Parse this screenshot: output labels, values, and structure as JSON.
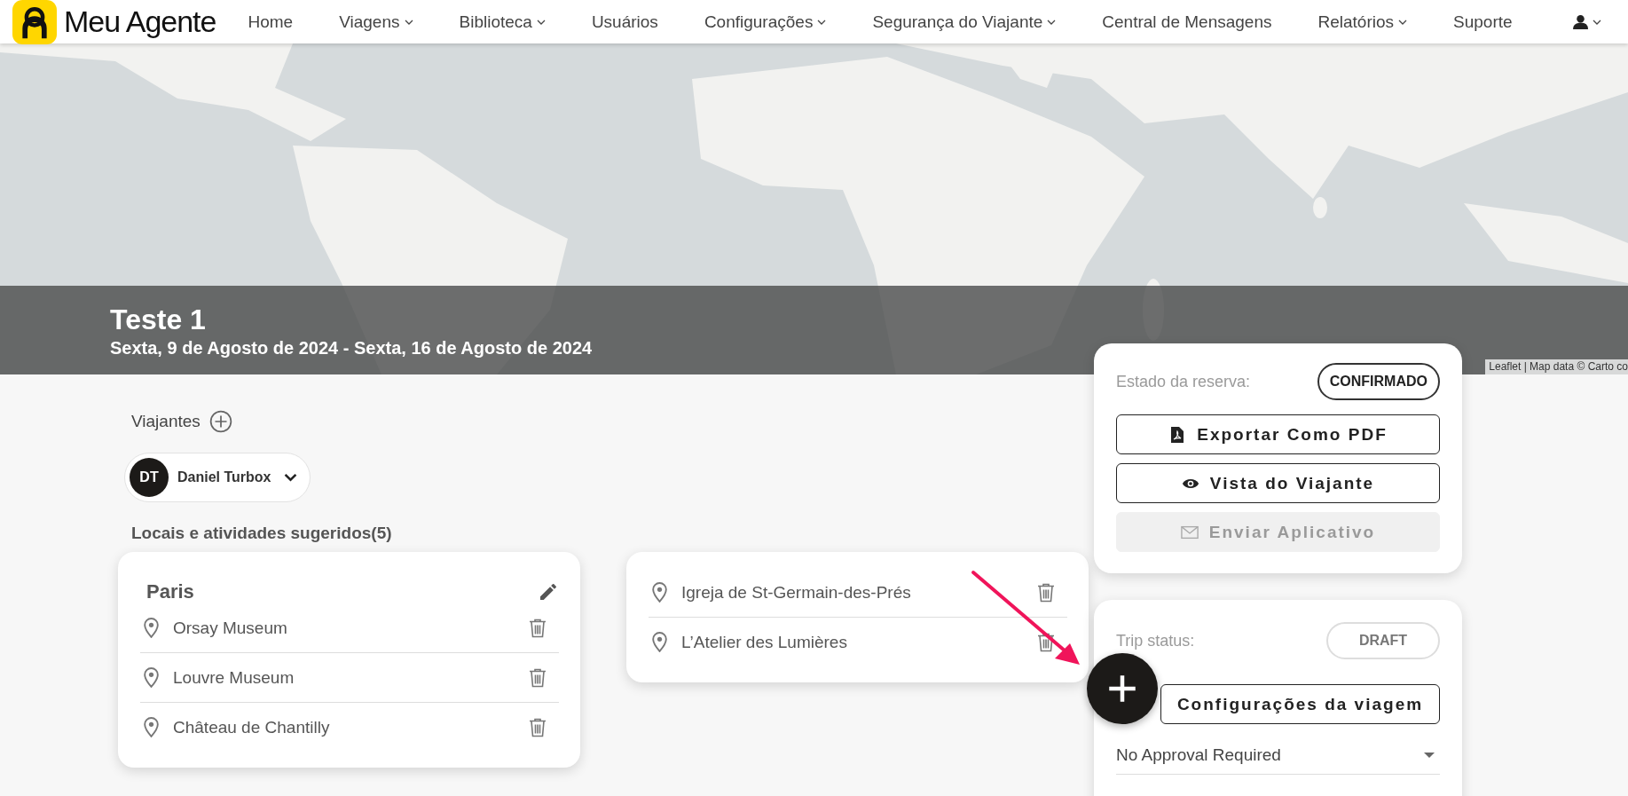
{
  "nav": {
    "brand": "Meu Agente",
    "items": [
      {
        "label": "Home",
        "dropdown": false
      },
      {
        "label": "Viagens",
        "dropdown": true
      },
      {
        "label": "Biblioteca",
        "dropdown": true
      },
      {
        "label": "Usuários",
        "dropdown": false
      },
      {
        "label": "Configurações",
        "dropdown": true
      },
      {
        "label": "Segurança do Viajante",
        "dropdown": true
      },
      {
        "label": "Central de Mensagens",
        "dropdown": false
      },
      {
        "label": "Relatórios",
        "dropdown": true
      },
      {
        "label": "Suporte",
        "dropdown": false
      }
    ],
    "user_menu": {
      "dropdown": true
    }
  },
  "map": {
    "kind": "picture",
    "attribution": "Leaflet | Map data © Carto co"
  },
  "trip": {
    "title": "Teste 1",
    "dates": "Sexta, 9 de Agosto de 2024 - Sexta, 16 de Agosto de 2024"
  },
  "travelers": {
    "label": "Viajantes",
    "list": [
      {
        "initials": "DT",
        "name": "Daniel Turbox"
      }
    ]
  },
  "suggestions": {
    "heading": "Locais e atividades sugeridos(5)",
    "groups": [
      {
        "title": "Paris",
        "editable": true,
        "places": [
          "Orsay Museum",
          "Louvre Museum",
          "Château de Chantilly"
        ]
      },
      {
        "editable": false,
        "places": [
          "Igreja de St-Germain-des-Prés",
          "L’Atelier des Lumières"
        ]
      }
    ]
  },
  "booking": {
    "label": "Estado da reserva:",
    "status": "CONFIRMADO",
    "actions": [
      {
        "label": "Exportar Como PDF",
        "disabled": false
      },
      {
        "label": "Vista do Viajante",
        "disabled": false
      },
      {
        "label": "Enviar Aplicativo",
        "disabled": true
      }
    ]
  },
  "trip_status": {
    "label": "Trip status:",
    "status": "DRAFT",
    "settings_button": "Configurações da viagem",
    "approval": "No Approval Required"
  }
}
